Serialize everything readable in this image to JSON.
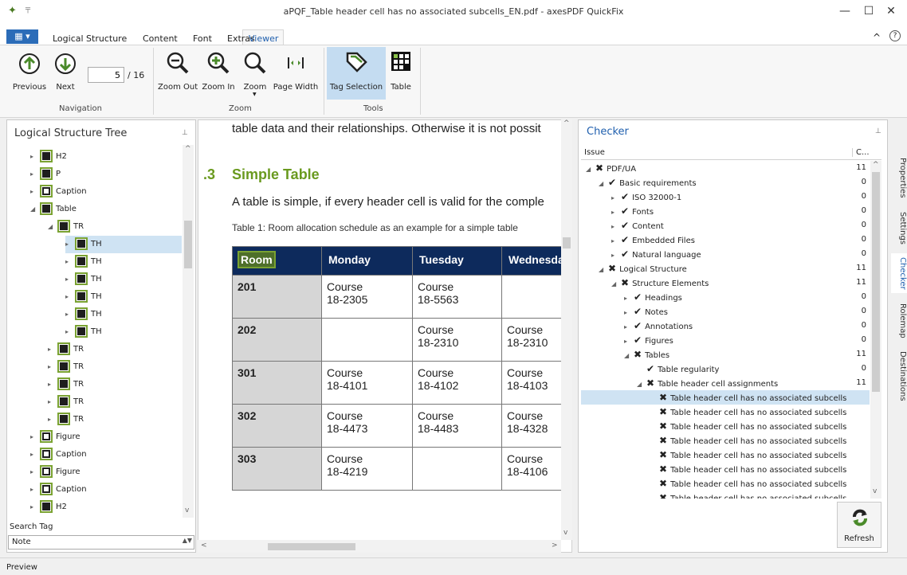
{
  "window": {
    "title": "aPQF_Table header cell has no associated subcells_EN.pdf - axesPDF QuickFix",
    "minimize": "—",
    "maximize": "☐",
    "close": "✕"
  },
  "ribbon": {
    "file_tab": "▦ ▾",
    "tabs": [
      "Logical Structure",
      "Content",
      "Font",
      "Extras",
      "Viewer"
    ],
    "active_tab": "Viewer",
    "navigation": {
      "previous": "Previous",
      "next": "Next",
      "page_value": "5",
      "page_total": "/ 16",
      "group": "Navigation"
    },
    "zoom": {
      "zoom_out": "Zoom Out",
      "zoom_in": "Zoom In",
      "zoom": "Zoom",
      "page_width": "Page Width",
      "group": "Zoom"
    },
    "tools": {
      "tag_selection": "Tag Selection",
      "table": "Table",
      "group": "Tools"
    },
    "collapse": "^",
    "help": "?"
  },
  "left": {
    "title": "Logical Structure Tree",
    "pin": "⊥",
    "items": [
      {
        "label": "H2",
        "indent": 0,
        "expand": "▸",
        "icon": "h2-icon"
      },
      {
        "label": "P",
        "indent": 0,
        "expand": "▸",
        "icon": "paragraph-icon"
      },
      {
        "label": "Caption",
        "indent": 0,
        "expand": "▸",
        "icon": "caption-icon"
      },
      {
        "label": "Table",
        "indent": 0,
        "expand": "◢",
        "icon": "table-icon"
      },
      {
        "label": "TR",
        "indent": 1,
        "expand": "◢",
        "icon": "tr-icon"
      },
      {
        "label": "TH",
        "indent": 2,
        "expand": "▸",
        "icon": "th-icon"
      },
      {
        "label": "TH",
        "indent": 2,
        "expand": "▸",
        "icon": "th-icon"
      },
      {
        "label": "TH",
        "indent": 2,
        "expand": "▸",
        "icon": "th-icon"
      },
      {
        "label": "TH",
        "indent": 2,
        "expand": "▸",
        "icon": "th-icon"
      },
      {
        "label": "TH",
        "indent": 2,
        "expand": "▸",
        "icon": "th-icon"
      },
      {
        "label": "TH",
        "indent": 2,
        "expand": "▸",
        "icon": "th-icon"
      },
      {
        "label": "TR",
        "indent": 1,
        "expand": "▸",
        "icon": "tr-icon"
      },
      {
        "label": "TR",
        "indent": 1,
        "expand": "▸",
        "icon": "tr-icon"
      },
      {
        "label": "TR",
        "indent": 1,
        "expand": "▸",
        "icon": "tr-icon"
      },
      {
        "label": "TR",
        "indent": 1,
        "expand": "▸",
        "icon": "tr-icon"
      },
      {
        "label": "TR",
        "indent": 1,
        "expand": "▸",
        "icon": "tr-icon"
      },
      {
        "label": "Figure",
        "indent": 0,
        "expand": "▸",
        "icon": "figure-icon"
      },
      {
        "label": "Caption",
        "indent": 0,
        "expand": "▸",
        "icon": "caption-icon"
      },
      {
        "label": "Figure",
        "indent": 0,
        "expand": "▸",
        "icon": "figure-icon"
      },
      {
        "label": "Caption",
        "indent": 0,
        "expand": "▸",
        "icon": "caption-icon"
      },
      {
        "label": "H2",
        "indent": 0,
        "expand": "▸",
        "icon": "h2-icon"
      }
    ],
    "selected_index": 5,
    "search_label": "Search Tag",
    "search_value": "Note"
  },
  "document": {
    "top_text": "table data and their relationships. Otherwise it is not possit",
    "section_number": ".3",
    "heading": "Simple Table",
    "body_text": "A table is simple, if every header cell is valid for the comple",
    "caption": "Table 1: Room allocation schedule as an example for a simple table",
    "header": [
      "Room",
      "Monday",
      "Tuesday",
      "Wednesda"
    ],
    "rows": [
      [
        "201",
        "Course\n18-2305",
        "Course\n18-5563",
        ""
      ],
      [
        "202",
        "",
        "Course\n18-2310",
        "Course\n18-2310"
      ],
      [
        "301",
        "Course\n18-4101",
        "Course\n18-4102",
        "Course\n18-4103"
      ],
      [
        "302",
        "Course\n18-4473",
        "Course\n18-4483",
        "Course\n18-4328"
      ],
      [
        "303",
        "Course\n18-4219",
        "",
        "Course\n18-4106"
      ]
    ]
  },
  "checker": {
    "title": "Checker",
    "pin": "⊥",
    "col_issue": "Issue",
    "col_count": "C...",
    "items": [
      {
        "label": "PDF/UA",
        "indent": 0,
        "status": "fail",
        "count": "11",
        "expand": "◢"
      },
      {
        "label": "Basic requirements",
        "indent": 1,
        "status": "ok",
        "count": "0",
        "expand": "◢"
      },
      {
        "label": "ISO 32000-1",
        "indent": 2,
        "status": "ok",
        "count": "0",
        "expand": "▸"
      },
      {
        "label": "Fonts",
        "indent": 2,
        "status": "ok",
        "count": "0",
        "expand": "▸"
      },
      {
        "label": "Content",
        "indent": 2,
        "status": "ok",
        "count": "0",
        "expand": "▸"
      },
      {
        "label": "Embedded Files",
        "indent": 2,
        "status": "ok",
        "count": "0",
        "expand": "▸"
      },
      {
        "label": "Natural language",
        "indent": 2,
        "status": "ok",
        "count": "0",
        "expand": "▸"
      },
      {
        "label": "Logical Structure",
        "indent": 1,
        "status": "fail",
        "count": "11",
        "expand": "◢"
      },
      {
        "label": "Structure Elements",
        "indent": 2,
        "status": "fail",
        "count": "11",
        "expand": "◢"
      },
      {
        "label": "Headings",
        "indent": 3,
        "status": "ok",
        "count": "0",
        "expand": "▸"
      },
      {
        "label": "Notes",
        "indent": 3,
        "status": "ok",
        "count": "0",
        "expand": "▸"
      },
      {
        "label": "Annotations",
        "indent": 3,
        "status": "ok",
        "count": "0",
        "expand": "▸"
      },
      {
        "label": "Figures",
        "indent": 3,
        "status": "ok",
        "count": "0",
        "expand": "▸"
      },
      {
        "label": "Tables",
        "indent": 3,
        "status": "fail",
        "count": "11",
        "expand": "◢"
      },
      {
        "label": "Table regularity",
        "indent": 4,
        "status": "ok",
        "count": "0",
        "expand": ""
      },
      {
        "label": "Table header cell assignments",
        "indent": 4,
        "status": "fail",
        "count": "11",
        "expand": "◢"
      },
      {
        "label": "Table header cell has no associated subcells",
        "indent": 5,
        "status": "fail",
        "count": "",
        "expand": ""
      },
      {
        "label": "Table header cell has no associated subcells",
        "indent": 5,
        "status": "fail",
        "count": "",
        "expand": ""
      },
      {
        "label": "Table header cell has no associated subcells",
        "indent": 5,
        "status": "fail",
        "count": "",
        "expand": ""
      },
      {
        "label": "Table header cell has no associated subcells",
        "indent": 5,
        "status": "fail",
        "count": "",
        "expand": ""
      },
      {
        "label": "Table header cell has no associated subcells",
        "indent": 5,
        "status": "fail",
        "count": "",
        "expand": ""
      },
      {
        "label": "Table header cell has no associated subcells",
        "indent": 5,
        "status": "fail",
        "count": "",
        "expand": ""
      },
      {
        "label": "Table header cell has no associated subcells",
        "indent": 5,
        "status": "fail",
        "count": "",
        "expand": ""
      },
      {
        "label": "Table header cell has no associated subcells",
        "indent": 5,
        "status": "fail",
        "count": "",
        "expand": ""
      }
    ],
    "selected_index": 16,
    "refresh": "Refresh"
  },
  "side_tabs": [
    "Properties",
    "Settings",
    "Checker",
    "Rolemap",
    "Destinations"
  ],
  "active_side_tab": "Checker",
  "status": {
    "preview": "Preview"
  },
  "colors": {
    "accent": "#1f5fae",
    "tag_border": "#7aa232",
    "table_header": "#0d2a5c",
    "heading_green": "#6a9a1f",
    "selection": "#cfe3f3"
  }
}
